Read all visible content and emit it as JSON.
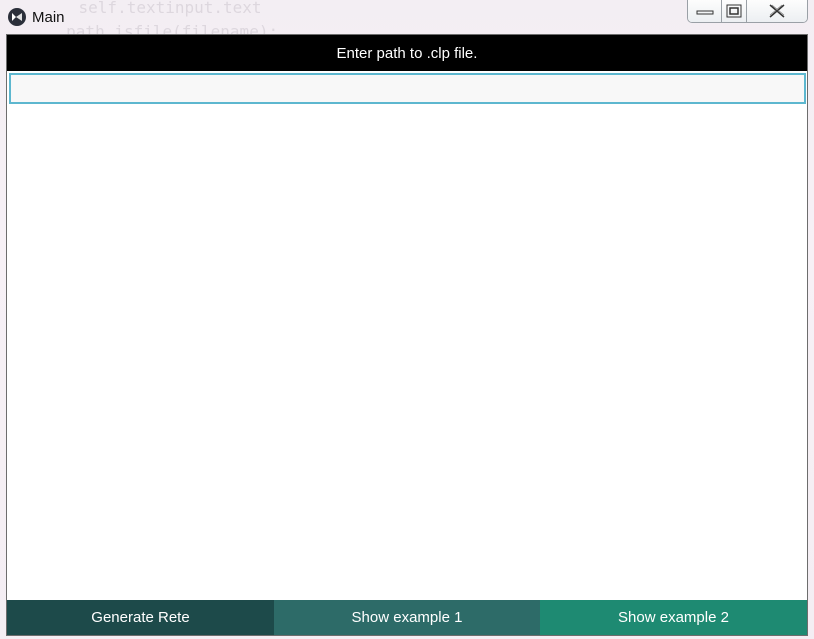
{
  "window": {
    "title": "Main",
    "controls": {
      "minimize": "minimize",
      "maximize": "maximize",
      "close": "close"
    }
  },
  "header": {
    "prompt": "Enter path to .clp file."
  },
  "path_input": {
    "value": "",
    "placeholder": ""
  },
  "buttons": {
    "generate": "Generate Rete",
    "example1": "Show example 1",
    "example2": "Show example 2"
  },
  "colors": {
    "header_bg": "#000000",
    "input_border": "#5db7cf",
    "generate_bg": "#1d4a4a",
    "example1_bg": "#2d6b68",
    "example2_bg": "#1e8a72"
  },
  "icons": {
    "app": "kivy-icon",
    "minimize": "minimize-icon",
    "maximize": "maximize-icon",
    "close": "close-icon"
  }
}
